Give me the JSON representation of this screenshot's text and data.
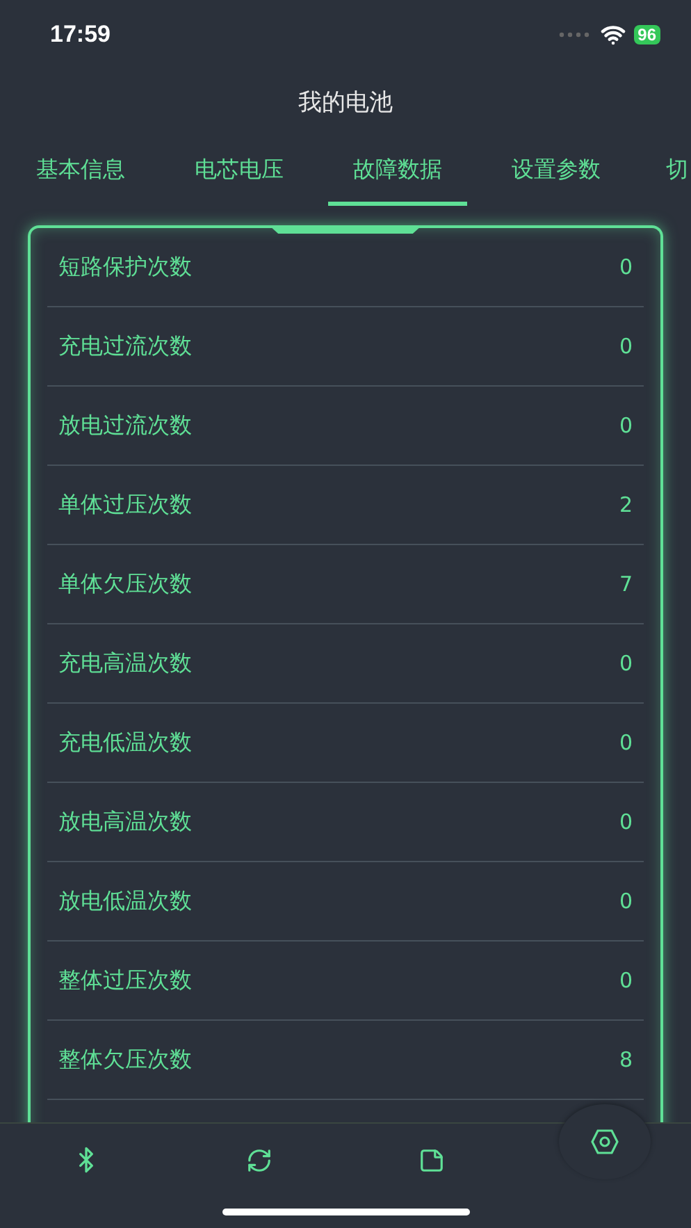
{
  "status_bar": {
    "time": "17:59",
    "battery": "96"
  },
  "title": "我的电池",
  "tabs": [
    {
      "label": "基本信息",
      "selected": false
    },
    {
      "label": "电芯电压",
      "selected": false
    },
    {
      "label": "故障数据",
      "selected": true
    },
    {
      "label": "设置参数",
      "selected": false
    },
    {
      "label": "切",
      "selected": false
    }
  ],
  "rows": [
    {
      "label": "短路保护次数",
      "value": "0"
    },
    {
      "label": "充电过流次数",
      "value": "0"
    },
    {
      "label": "放电过流次数",
      "value": "0"
    },
    {
      "label": "单体过压次数",
      "value": "2"
    },
    {
      "label": "单体欠压次数",
      "value": "7"
    },
    {
      "label": "充电高温次数",
      "value": "0"
    },
    {
      "label": "充电低温次数",
      "value": "0"
    },
    {
      "label": "放电高温次数",
      "value": "0"
    },
    {
      "label": "放电低温次数",
      "value": "0"
    },
    {
      "label": "整体过压次数",
      "value": "0"
    },
    {
      "label": "整体欠压次数",
      "value": "8"
    }
  ],
  "nav": [
    {
      "kind": "bluetooth",
      "selected": false
    },
    {
      "kind": "refresh",
      "selected": false
    },
    {
      "kind": "note",
      "selected": false
    },
    {
      "kind": "settings",
      "selected": true
    }
  ]
}
